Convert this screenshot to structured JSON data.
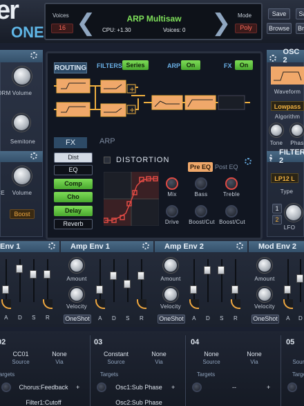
{
  "logo": {
    "part1": "er",
    "part2": "ONE"
  },
  "header": {
    "voices_label": "Voices",
    "voices_value": "16",
    "preset": "ARP Multisaw",
    "cpu": "CPU: +1.30",
    "voices_count": "Voices: 0",
    "mode_label": "Mode",
    "mode_value": "Poly",
    "save": "Save",
    "browse": "Browse",
    "save_partial": "Sa",
    "browse_partial": "Bro"
  },
  "left": {
    "volume": "Volume",
    "semitone": "Semitone",
    "form1": "ORM",
    "form2": "CE",
    "boost": "Boost"
  },
  "routing": {
    "title": "ROUTING",
    "filters_label": "FILTERS",
    "filters_value": "Series",
    "arp_label": "ARP",
    "arp_value": "On",
    "fx_label": "FX",
    "fx_value": "On"
  },
  "fx": {
    "tab_fx": "FX",
    "tab_arp": "ARP",
    "list": [
      "Dist",
      "EQ",
      "Comp",
      "Cho",
      "Delay",
      "Reverb"
    ],
    "title": "DISTORTION",
    "pre_eq": "Pre EQ",
    "post_eq": "Post EQ",
    "knobs": [
      "Mix",
      "Bass",
      "Treble",
      "Drive",
      "Boost/Cut",
      "Boost/Cut"
    ]
  },
  "osc2": {
    "title": "OSC 2",
    "waveform": "Waveform",
    "filter_type": "Lowpass",
    "algorithm": "Algorithm",
    "tone": "Tone",
    "phase": "Phas"
  },
  "filter2": {
    "title": "FILTER 2",
    "type_value": "LP12 L",
    "type_label": "Type",
    "lfo": "LFO",
    "b1": "1",
    "b2": "2"
  },
  "env": {
    "sections": [
      "Env 1",
      "Amp Env 1",
      "Amp Env 2",
      "Mod Env 2"
    ],
    "amount": "Amount",
    "velocity": "Velocity",
    "oneshot": "OneShot",
    "adsr": [
      "A",
      "D",
      "S",
      "R"
    ]
  },
  "mod": {
    "slots": [
      {
        "num": "02",
        "src": "CC01",
        "via": "None",
        "target": "Chorus:Feedback",
        "target2": "Filter1:Cutoff"
      },
      {
        "num": "03",
        "src": "Constant",
        "via": "None",
        "target": "Osc1:Sub Phase",
        "target2": "Osc2:Sub Phase"
      },
      {
        "num": "04",
        "src": "None",
        "via": "None",
        "target": "--",
        "target2": ""
      },
      {
        "num": "05",
        "src": "",
        "via": "",
        "target": "",
        "target2": ""
      }
    ],
    "source": "Source",
    "via": "Via",
    "targets": "Targets",
    "plus": "+"
  }
}
